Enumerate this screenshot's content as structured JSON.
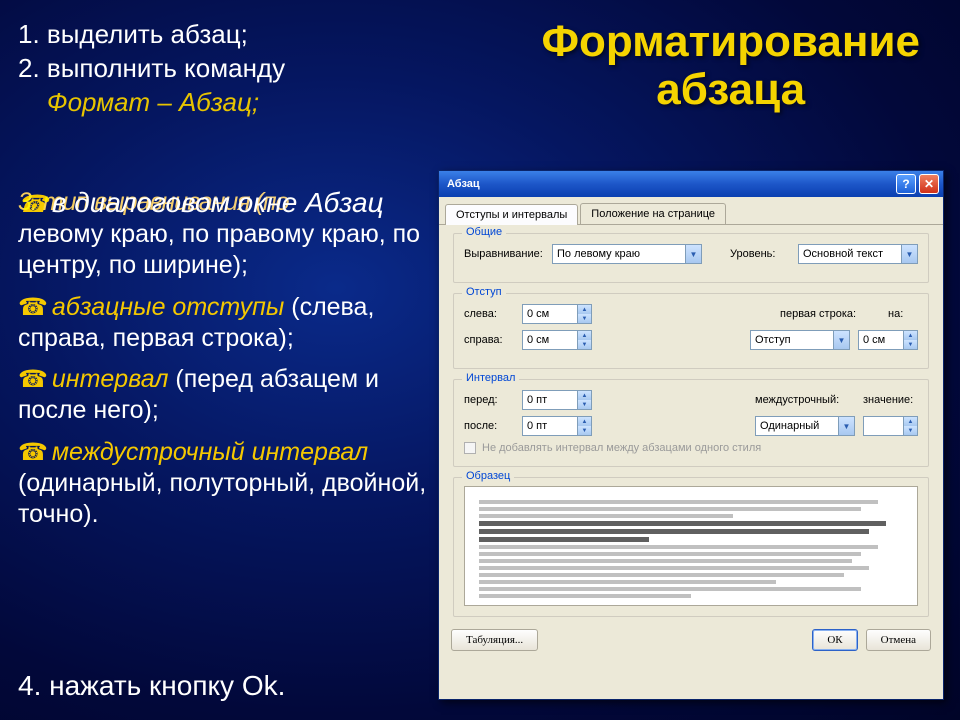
{
  "slide": {
    "title_l1": "Форматирование",
    "title_l2": "абзаца",
    "step1": "1. выделить абзац;",
    "step2": "2. выполнить команду",
    "step2_cmd": "Формат – Абзац;",
    "overlap_a": "3. тип выравнивания (по",
    "overlap_b": "в диалоговом окне Абзац",
    "align_rest": "левому краю, по правому краю, по центру, по ширине);",
    "b2_term": "абзацные отступы",
    "b2_rest": " (слева, справа, первая строка);",
    "b3_term": "интервал",
    "b3_rest": " (перед абзацем и после него);",
    "b4_term": "междустрочный интервал",
    "b4_rest": "(одинарный, полуторный, двойной, точно).",
    "step4": "4. нажать кнопку Ok."
  },
  "dialog": {
    "title": "Абзац",
    "tab1": "Отступы и интервалы",
    "tab2": "Положение на странице",
    "grp_general": "Общие",
    "lbl_align": "Выравнивание:",
    "val_align": "По левому краю",
    "lbl_level": "Уровень:",
    "val_level": "Основной текст",
    "grp_indent": "Отступ",
    "lbl_left": "слева:",
    "val_left": "0 см",
    "lbl_right": "справа:",
    "val_right": "0 см",
    "lbl_firstline": "первая строка:",
    "val_firstline": "Отступ",
    "lbl_by": "на:",
    "val_by": "0 см",
    "grp_spacing": "Интервал",
    "lbl_before": "перед:",
    "val_before": "0 пт",
    "lbl_after": "после:",
    "val_after": "0 пт",
    "lbl_linespace": "междустрочный:",
    "val_linespace": "Одинарный",
    "lbl_at": "значение:",
    "chk_nospace": "Не добавлять интервал между абзацами одного стиля",
    "grp_preview": "Образец",
    "btn_tabs": "Табуляция...",
    "btn_ok": "ОК",
    "btn_cancel": "Отмена"
  }
}
